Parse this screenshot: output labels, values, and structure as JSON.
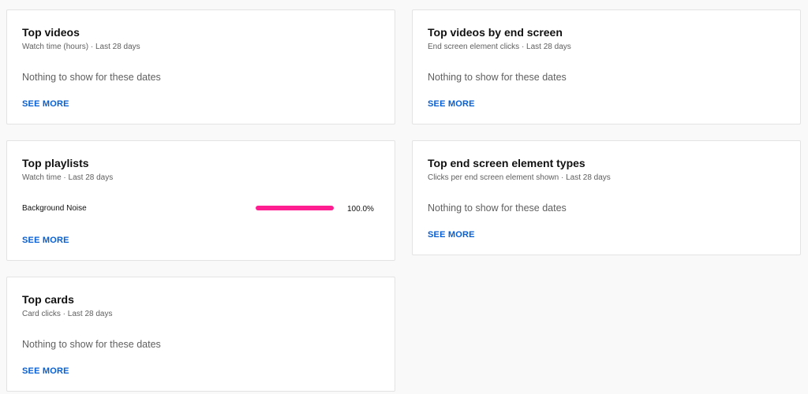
{
  "cards": {
    "top_videos": {
      "title": "Top videos",
      "subtitle": "Watch time (hours) · Last 28 days",
      "empty": "Nothing to show for these dates",
      "see_more": "SEE MORE"
    },
    "top_videos_end_screen": {
      "title": "Top videos by end screen",
      "subtitle": "End screen element clicks · Last 28 days",
      "empty": "Nothing to show for these dates",
      "see_more": "SEE MORE"
    },
    "top_playlists": {
      "title": "Top playlists",
      "subtitle": "Watch time · Last 28 days",
      "rows": [
        {
          "label": "Background Noise",
          "percent_text": "100.0%",
          "fraction": 1.0
        }
      ],
      "bar_color": "#ff1e91",
      "see_more": "SEE MORE"
    },
    "top_end_screen_types": {
      "title": "Top end screen element types",
      "subtitle": "Clicks per end screen element shown · Last 28 days",
      "empty": "Nothing to show for these dates",
      "see_more": "SEE MORE"
    },
    "top_cards": {
      "title": "Top cards",
      "subtitle": "Card clicks · Last 28 days",
      "empty": "Nothing to show for these dates",
      "see_more": "SEE MORE"
    }
  },
  "colors": {
    "link": "#065fd4",
    "page_background": "#f9f9f9",
    "card_background": "#ffffff"
  }
}
